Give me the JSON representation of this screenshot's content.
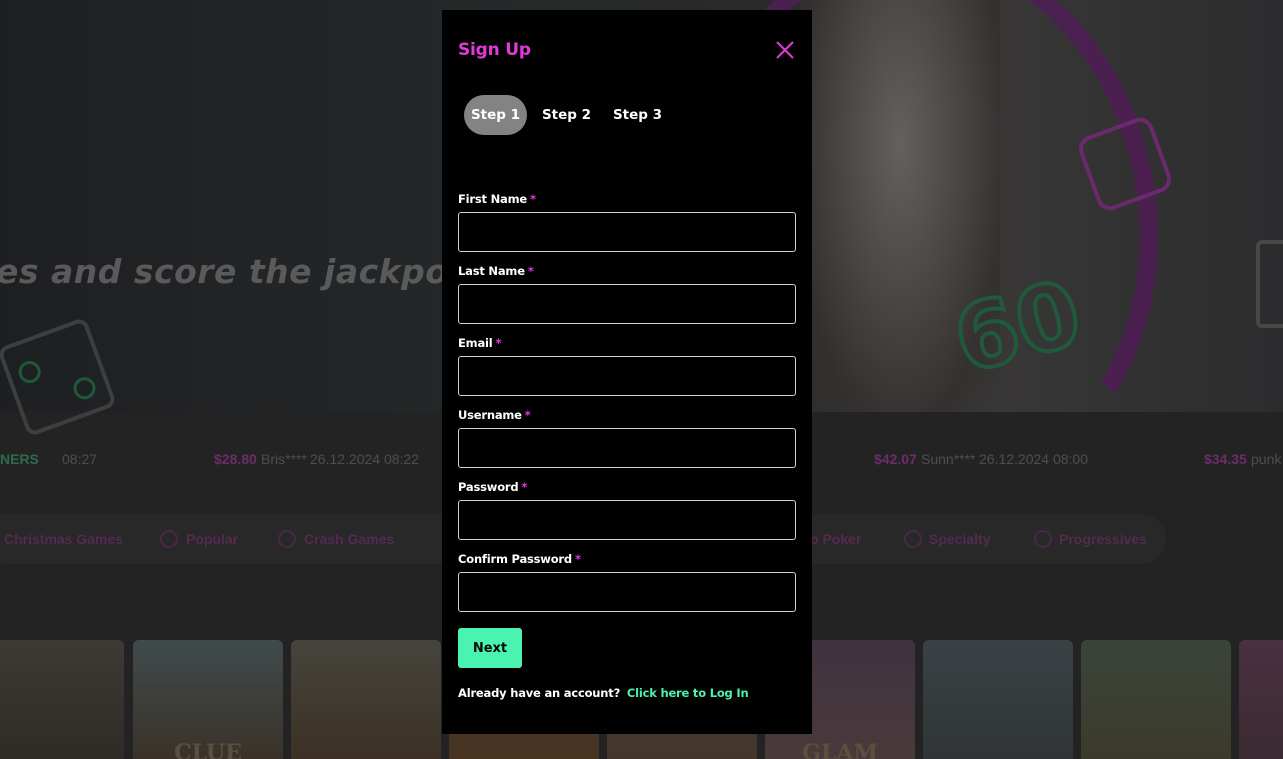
{
  "background": {
    "hero_text": "es and score the jackpots!",
    "ticker": {
      "label": "NERS",
      "first_time": "08:27",
      "items": [
        {
          "amount": "$28.80",
          "user": "Bris****",
          "time": "26.12.2024 08:22"
        },
        {
          "amount": "$42.07",
          "user": "Sunn****",
          "time": "26.12.2024 08:00"
        },
        {
          "amount": "$34.35",
          "user": "punk",
          "time": ""
        }
      ]
    },
    "categories": [
      "Christmas Games",
      "Popular",
      "Crash Games",
      "o Poker",
      "Specialty",
      "Progressives"
    ],
    "game_tiles": [
      "",
      "CLUE",
      "",
      "",
      "",
      "GLAM",
      "",
      "",
      ""
    ]
  },
  "modal": {
    "title": "Sign Up",
    "close_icon": "close-icon",
    "steps": [
      {
        "label": "Step 1",
        "active": true
      },
      {
        "label": "Step 2",
        "active": false
      },
      {
        "label": "Step 3",
        "active": false
      }
    ],
    "fields": {
      "first_name": {
        "label": "First Name",
        "required_mark": "*",
        "value": ""
      },
      "last_name": {
        "label": "Last Name",
        "required_mark": "*",
        "value": ""
      },
      "email": {
        "label": "Email",
        "required_mark": "*",
        "value": ""
      },
      "username": {
        "label": "Username",
        "required_mark": "*",
        "value": ""
      },
      "password": {
        "label": "Password",
        "required_mark": "*",
        "value": ""
      },
      "confirm_password": {
        "label": "Confirm Password",
        "required_mark": "*",
        "value": ""
      }
    },
    "next_label": "Next",
    "login_prompt": "Already have an account?",
    "login_link": "Click here to Log In"
  },
  "colors": {
    "accent_pink": "#e23ad9",
    "accent_green": "#4bf3b0",
    "modal_bg": "#010101",
    "step_active_bg": "#838383"
  }
}
